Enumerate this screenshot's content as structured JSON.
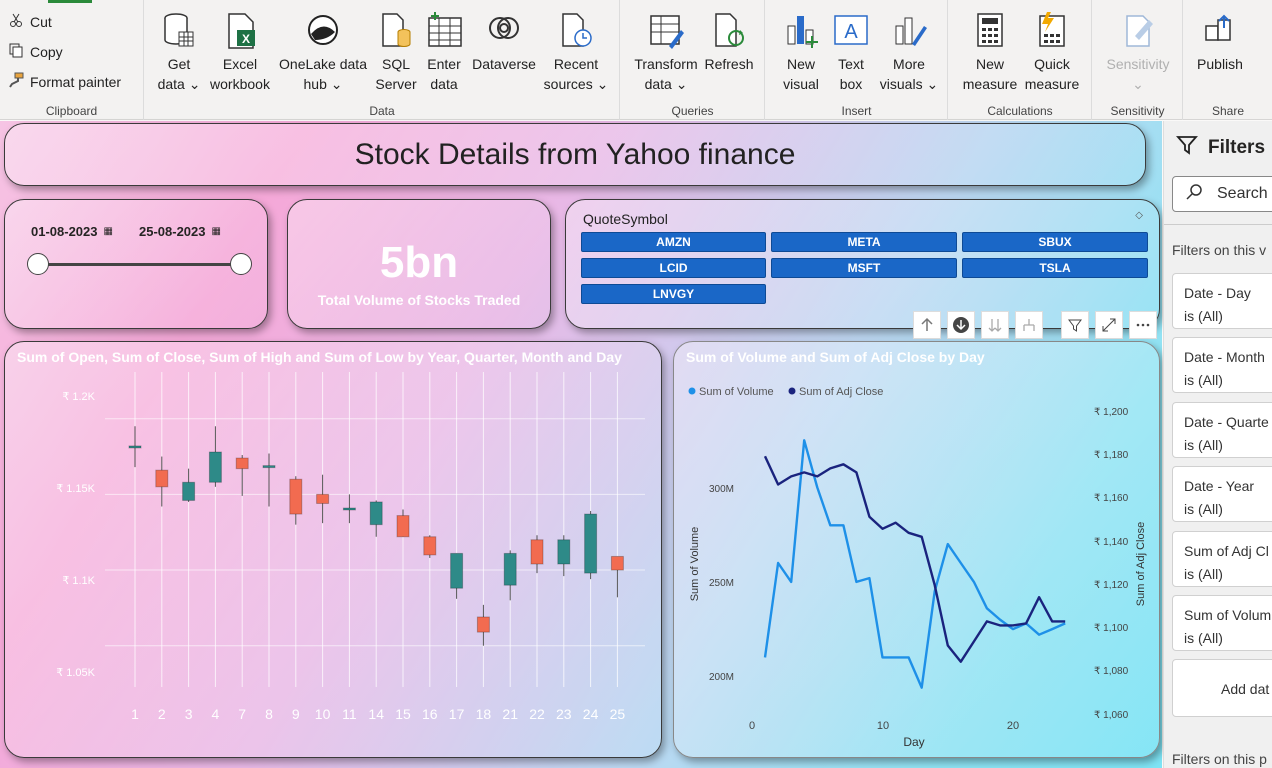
{
  "ribbon": {
    "clipboard": {
      "cut": "Cut",
      "copy": "Copy",
      "format_painter": "Format painter",
      "label": "Clipboard"
    },
    "data": {
      "label": "Data",
      "get_data": [
        "Get",
        "data ⌄"
      ],
      "excel": [
        "Excel",
        "workbook"
      ],
      "onelake": [
        "OneLake data",
        "hub ⌄"
      ],
      "sql": [
        "SQL",
        "Server"
      ],
      "enter": [
        "Enter",
        "data"
      ],
      "dataverse": [
        "Dataverse",
        ""
      ],
      "recent": [
        "Recent",
        "sources ⌄"
      ]
    },
    "queries": {
      "label": "Queries",
      "transform": [
        "Transform",
        "data ⌄"
      ],
      "refresh": [
        "Refresh",
        ""
      ]
    },
    "insert": {
      "label": "Insert",
      "new_visual": [
        "New",
        "visual"
      ],
      "text_box": [
        "Text",
        "box"
      ],
      "more_visuals": [
        "More",
        "visuals ⌄"
      ]
    },
    "calculations": {
      "label": "Calculations",
      "new_measure": [
        "New",
        "measure"
      ],
      "quick_measure": [
        "Quick",
        "measure"
      ]
    },
    "sensitivity": {
      "label": "Sensitivity",
      "button": [
        "Sensitivity",
        "⌄"
      ]
    },
    "share": {
      "label": "Share",
      "publish": "Publish"
    }
  },
  "title": "Stock Details from Yahoo finance",
  "date_slicer": {
    "start": "01-08-2023",
    "end": "25-08-2023",
    "start_pos": 0,
    "end_pos": 1
  },
  "kpi": {
    "value": "5bn",
    "label": "Total Volume of Stocks Traded"
  },
  "symbol_slicer": {
    "title": "QuoteSymbol",
    "symbols": [
      "AMZN",
      "META",
      "SBUX",
      "LCID",
      "MSFT",
      "TSLA",
      "LNVGY"
    ]
  },
  "candle_chart": {
    "title": "Sum of Open, Sum of Close, Sum of High and Sum of Low by Year, Quarter, Month and Day",
    "y_ticks": [
      "₹ 1.2K",
      "₹ 1.15K",
      "₹ 1.1K",
      "₹ 1.05K"
    ],
    "colors": {
      "up": "#2e8a88",
      "down": "#f26b50"
    }
  },
  "line_chart": {
    "title": "Sum of Volume and Sum of Adj Close by Day",
    "legend": [
      "Sum of Volume",
      "Sum of Adj Close"
    ],
    "colors": [
      "#1e90e8",
      "#1a237e"
    ],
    "xlabel": "Day",
    "ylabel_left": "Sum of Volume",
    "ylabel_right": "Sum of Adj Close",
    "x_ticks": [
      "0",
      "10",
      "20"
    ],
    "y_left_ticks": [
      "300M",
      "250M",
      "200M"
    ],
    "y_right_ticks": [
      "₹ 1,200",
      "₹ 1,180",
      "₹ 1,160",
      "₹ 1,140",
      "₹ 1,120",
      "₹ 1,100",
      "₹ 1,080",
      "₹ 1,060"
    ]
  },
  "chart_data": [
    {
      "type": "candlestick",
      "categories": [
        "1",
        "2",
        "3",
        "4",
        "7",
        "8",
        "9",
        "10",
        "11",
        "14",
        "15",
        "16",
        "17",
        "18",
        "21",
        "22",
        "23",
        "24",
        "25"
      ],
      "ylim": [
        1030,
        1215
      ],
      "open": [
        1182,
        1166,
        1146,
        1158,
        1174,
        1169,
        1160,
        1150,
        1141,
        1130,
        1136,
        1122,
        1088,
        1069,
        1090,
        1120,
        1104,
        1098,
        1109
      ],
      "close": [
        1182,
        1155,
        1158,
        1178,
        1167,
        1169,
        1137,
        1144,
        1141,
        1145,
        1122,
        1110,
        1111,
        1059,
        1111,
        1104,
        1120,
        1137,
        1100
      ],
      "high": [
        1195,
        1175,
        1167,
        1195,
        1176,
        1177,
        1162,
        1163,
        1150,
        1146,
        1140,
        1123,
        1111,
        1077,
        1113,
        1123,
        1123,
        1139,
        1109
      ],
      "low": [
        1168,
        1142,
        1145,
        1155,
        1149,
        1142,
        1130,
        1131,
        1131,
        1122,
        1122,
        1108,
        1081,
        1050,
        1080,
        1098,
        1096,
        1094,
        1082
      ]
    },
    {
      "type": "line",
      "xlim": [
        0,
        25
      ],
      "series": [
        {
          "name": "Sum of Volume",
          "axis": "left",
          "ylim": [
            180,
            340
          ],
          "x": [
            1,
            2,
            3,
            4,
            5,
            6,
            7,
            8,
            9,
            10,
            11,
            12,
            13,
            14,
            15,
            16,
            17,
            18,
            19,
            20,
            21,
            22,
            23,
            24
          ],
          "y": [
            210,
            260,
            250,
            325,
            300,
            280,
            280,
            250,
            252,
            210,
            210,
            210,
            194,
            245,
            270,
            260,
            250,
            236,
            230,
            225,
            228,
            222,
            225,
            228
          ]
        },
        {
          "name": "Sum of Adj Close",
          "axis": "right",
          "ylim": [
            1055,
            1205
          ],
          "x": [
            1,
            2,
            3,
            4,
            5,
            6,
            7,
            8,
            9,
            10,
            11,
            12,
            13,
            14,
            15,
            16,
            17,
            18,
            19,
            20,
            21,
            22,
            23,
            24
          ],
          "y": [
            1183,
            1169,
            1173,
            1175,
            1173,
            1177,
            1179,
            1175,
            1153,
            1147,
            1150,
            1145,
            1143,
            1119,
            1089,
            1081,
            1091,
            1101,
            1099,
            1099,
            1100,
            1113,
            1101,
            1101
          ]
        }
      ]
    }
  ],
  "filters": {
    "title": "Filters",
    "search": "Search",
    "on_visual": "Filters on this v",
    "items": [
      {
        "name": "Date - Day",
        "state": "is (All)"
      },
      {
        "name": "Date - Month",
        "state": "is (All)"
      },
      {
        "name": "Date - Quarte",
        "state": "is (All)"
      },
      {
        "name": "Date - Year",
        "state": "is (All)"
      },
      {
        "name": "Sum of Adj Cl",
        "state": "is (All)"
      },
      {
        "name": "Sum of Volum",
        "state": "is (All)"
      }
    ],
    "add_data": "Add dat",
    "on_page": "Filters on this p"
  }
}
